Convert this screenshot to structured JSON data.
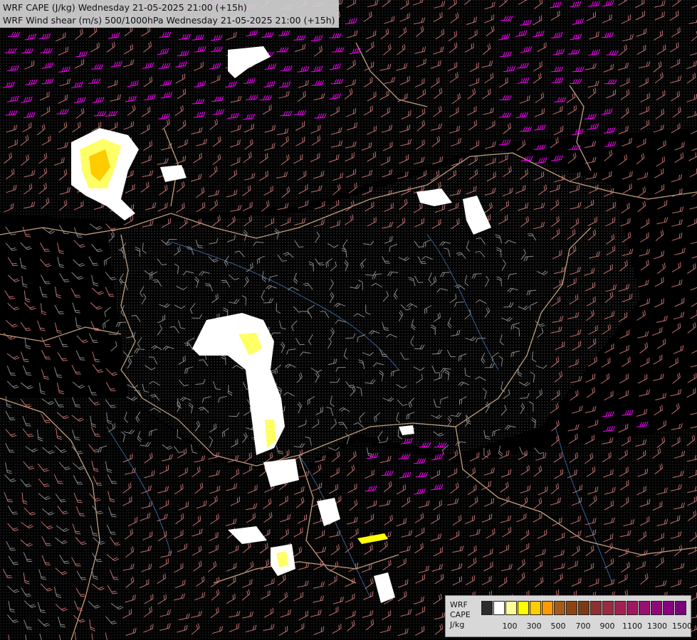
{
  "header": {
    "line1": "WRF CAPE (J/kg) Wednesday 21-05-2025 21:00 (+15h)",
    "line2": "WRF Wind shear (m/s) 500/1000hPa Wednesday 21-05-2025 21:00 (+15h)"
  },
  "legend": {
    "label_lines": [
      "WRF",
      "CAPE",
      "J/kg"
    ],
    "ticks": [
      "100",
      "300",
      "500",
      "700",
      "900",
      "1100",
      "1300",
      "1500"
    ],
    "colors": [
      "#2b2b2b",
      "#ffffff",
      "#ffff99",
      "#ffff00",
      "#ffcc00",
      "#ff9900",
      "#a35a1a",
      "#8b4513",
      "#7a3b14",
      "#8c3030",
      "#9a2a40",
      "#a52050",
      "#a01860",
      "#98106e",
      "#900878",
      "#880080",
      "#7a007a"
    ]
  },
  "map_colors": {
    "background": "#000000",
    "dots": "#6a6a6a",
    "border": "#d8b08a",
    "river": "#3a6aa8",
    "barb_low": "#8a8a8a",
    "barb_mid": "#c07070",
    "barb_high": "#ff00ff",
    "cape_low": "#ffffff",
    "cape_mid": "#ffff66",
    "cape_high": "#ffcc00"
  }
}
